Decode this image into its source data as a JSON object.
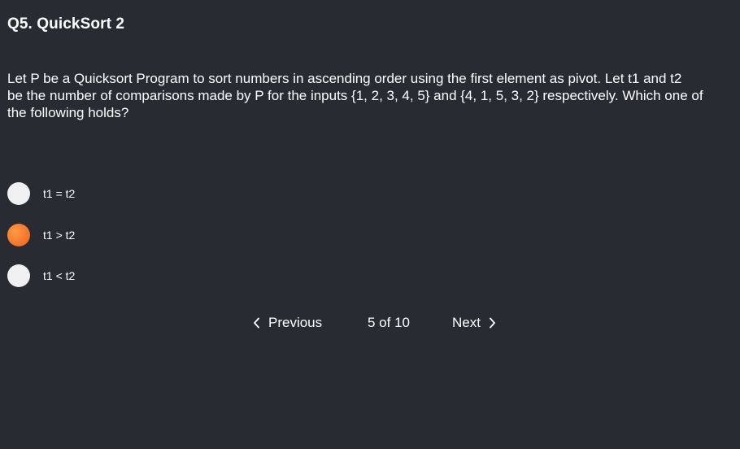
{
  "question": {
    "title": "Q5. QuickSort 2",
    "text_lines": [
      "Let P be a Quicksort Program to sort numbers in ascending order using the first element as pivot. Let t1 and t2",
      "be the number of comparisons made by P for the inputs {1, 2, 3, 4, 5} and {4, 1, 5, 3, 2} respectively. Which one of",
      "the following holds?"
    ]
  },
  "options": [
    {
      "label": "t1 = t2",
      "selected": false
    },
    {
      "label": "t1 > t2",
      "selected": true
    },
    {
      "label": "t1 < t2",
      "selected": false
    }
  ],
  "pagination": {
    "previous_label": "Previous",
    "page_indicator": "5 of 10",
    "next_label": "Next"
  },
  "colors": {
    "background": "#292b33",
    "radio_unselected": "#f0f0f2",
    "radio_selected": "#f5792e",
    "text": "#ffffff"
  },
  "icons": {
    "previous": "chevron-left-icon",
    "next": "chevron-right-icon"
  }
}
